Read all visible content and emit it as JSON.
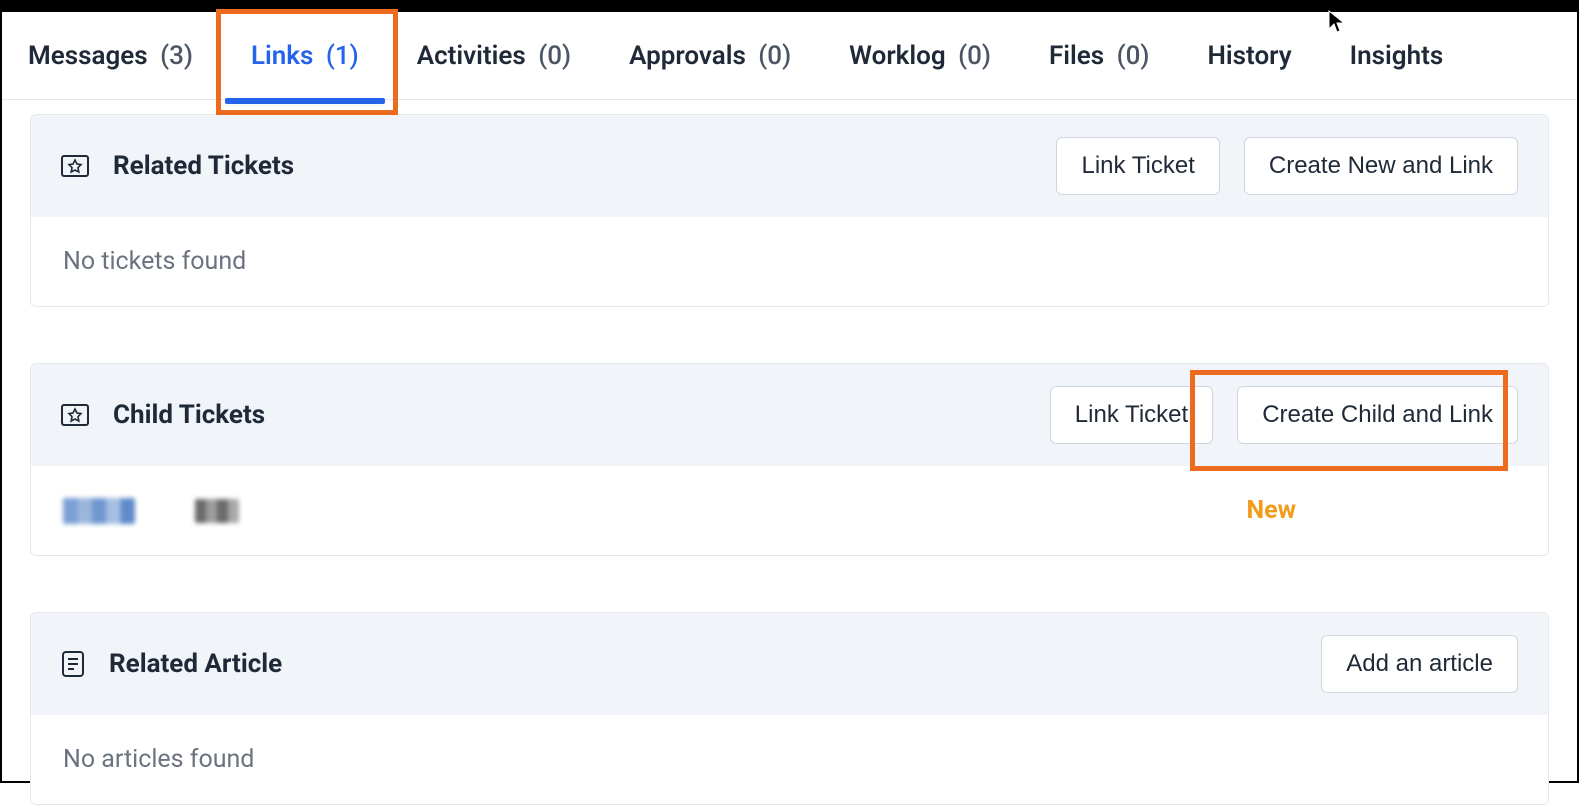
{
  "tabs": [
    {
      "label": "Messages",
      "count": "(3)",
      "active": false
    },
    {
      "label": "Links",
      "count": "(1)",
      "active": true
    },
    {
      "label": "Activities",
      "count": "(0)",
      "active": false
    },
    {
      "label": "Approvals",
      "count": "(0)",
      "active": false
    },
    {
      "label": "Worklog",
      "count": "(0)",
      "active": false
    },
    {
      "label": "Files",
      "count": "(0)",
      "active": false
    },
    {
      "label": "History",
      "count": "",
      "active": false
    },
    {
      "label": "Insights",
      "count": "",
      "active": false
    }
  ],
  "related_tickets": {
    "title": "Related Tickets",
    "link_btn": "Link Ticket",
    "create_btn": "Create New and Link",
    "empty": "No tickets found"
  },
  "child_tickets": {
    "title": "Child Tickets",
    "link_btn": "Link Ticket",
    "create_btn": "Create Child and Link",
    "row": {
      "status": "New"
    }
  },
  "related_article": {
    "title": "Related Article",
    "add_btn": "Add an article",
    "empty": "No articles found"
  }
}
